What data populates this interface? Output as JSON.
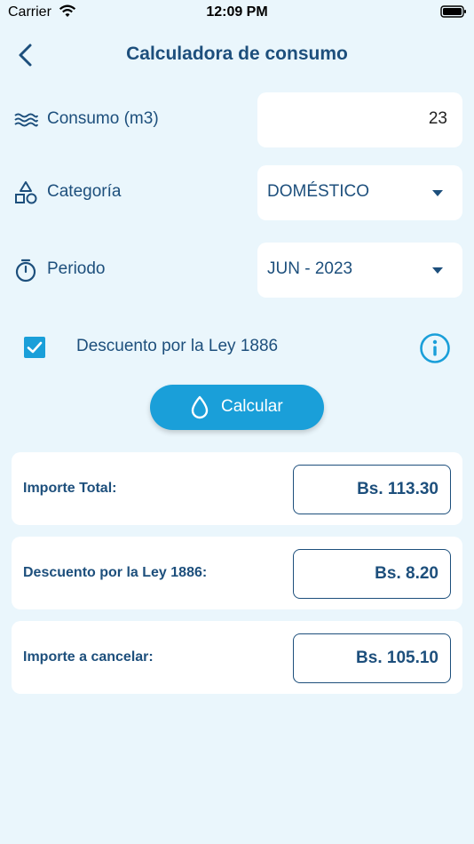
{
  "status_bar": {
    "carrier": "Carrier",
    "time": "12:09 PM"
  },
  "header": {
    "title": "Calculadora de consumo"
  },
  "form": {
    "consumo": {
      "label": "Consumo (m3)",
      "value": "23"
    },
    "categoria": {
      "label": "Categoría",
      "value": "DOMÉSTICO"
    },
    "periodo": {
      "label": "Periodo",
      "value": "JUN - 2023"
    }
  },
  "discount": {
    "label": "Descuento por la Ley 1886",
    "checked": true
  },
  "calculate_button": {
    "label": "Calcular"
  },
  "results": {
    "importe_total": {
      "label": "Importe Total:",
      "value": "Bs. 113.30"
    },
    "descuento": {
      "label": "Descuento por la Ley 1886:",
      "value": "Bs. 8.20"
    },
    "importe_cancelar": {
      "label": "Importe a cancelar:",
      "value": "Bs. 105.10"
    }
  },
  "colors": {
    "background": "#eaf6fc",
    "primary": "#1a9fd9",
    "text": "#1d4f7c",
    "card": "#ffffff"
  }
}
